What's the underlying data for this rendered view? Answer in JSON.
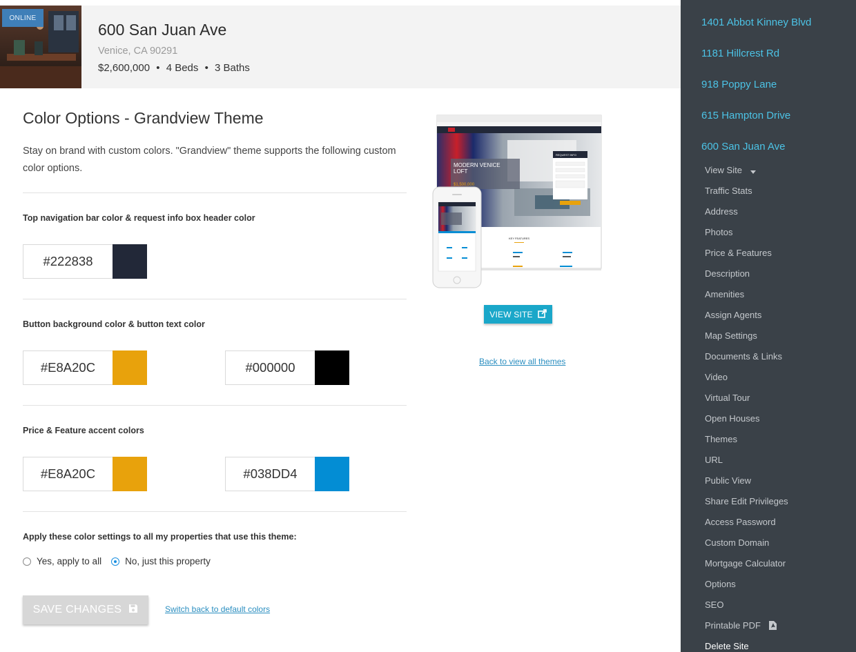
{
  "header": {
    "badge": "ONLINE",
    "address": "600 San Juan Ave",
    "city": "Venice, CA 90291",
    "price": "$2,600,000",
    "beds": "4 Beds",
    "baths": "3 Baths",
    "separator": "•"
  },
  "main": {
    "title": "Color Options - Grandview Theme",
    "intro": "Stay on brand with custom colors. \"Grandview\" theme supports the following custom color options.",
    "sections": [
      {
        "label": "Top navigation bar color & request info box header color",
        "colors": [
          {
            "hex": "#222838",
            "color": "#222838"
          }
        ]
      },
      {
        "label": "Button background color & button text color",
        "colors": [
          {
            "hex": "#E8A20C",
            "color": "#E8A20C"
          },
          {
            "hex": "#000000",
            "color": "#000000"
          }
        ]
      },
      {
        "label": "Price & Feature accent colors",
        "colors": [
          {
            "hex": "#E8A20C",
            "color": "#E8A20C"
          },
          {
            "hex": "#038DD4",
            "color": "#038DD4"
          }
        ]
      }
    ],
    "apply": {
      "label": "Apply these color settings to all my properties that use this theme:",
      "options": [
        {
          "label": "Yes, apply to all",
          "checked": false
        },
        {
          "label": "No, just this property",
          "checked": true
        }
      ]
    },
    "save_label": "SAVE CHANGES",
    "save_icon": "floppy-disk-icon",
    "reset_link": "Switch back to default colors"
  },
  "preview": {
    "hero_title_1": "MODERN VENICE",
    "hero_title_2": "LOFT",
    "hero_price": "$1,500,000",
    "request_info": "REQUEST INFO",
    "key_features": "KEY FEATURES",
    "view_site_label": "VIEW SITE",
    "view_site_icon": "external-link-icon",
    "back_link": "Back to view all themes"
  },
  "sidebar": {
    "properties": [
      "1401 Abbot Kinney Blvd",
      "1181 Hillcrest Rd",
      "918 Poppy Lane",
      "615 Hampton Drive",
      "600 San Juan Ave"
    ],
    "menu": [
      {
        "label": "View Site",
        "icon": "caret-down-icon"
      },
      {
        "label": "Traffic Stats"
      },
      {
        "label": "Address"
      },
      {
        "label": "Photos"
      },
      {
        "label": "Price & Features"
      },
      {
        "label": "Description"
      },
      {
        "label": "Amenities"
      },
      {
        "label": "Assign Agents"
      },
      {
        "label": "Map Settings"
      },
      {
        "label": "Documents & Links"
      },
      {
        "label": "Video"
      },
      {
        "label": "Virtual Tour"
      },
      {
        "label": "Open Houses"
      },
      {
        "label": "Themes"
      },
      {
        "label": "URL"
      },
      {
        "label": "Public View"
      },
      {
        "label": "Share Edit Privileges"
      },
      {
        "label": "Access Password"
      },
      {
        "label": "Custom Domain"
      },
      {
        "label": "Mortgage Calculator"
      },
      {
        "label": "Options"
      },
      {
        "label": "SEO"
      },
      {
        "label": "Printable PDF",
        "icon": "pdf-file-icon"
      },
      {
        "label": "Delete Site",
        "active": true
      }
    ]
  },
  "colors": {
    "sidebar_bg": "#3a4148",
    "sidebar_link": "#4cc3e6",
    "accent_blue": "#1aa7c9",
    "save_disabled": "#d7d7d7"
  }
}
